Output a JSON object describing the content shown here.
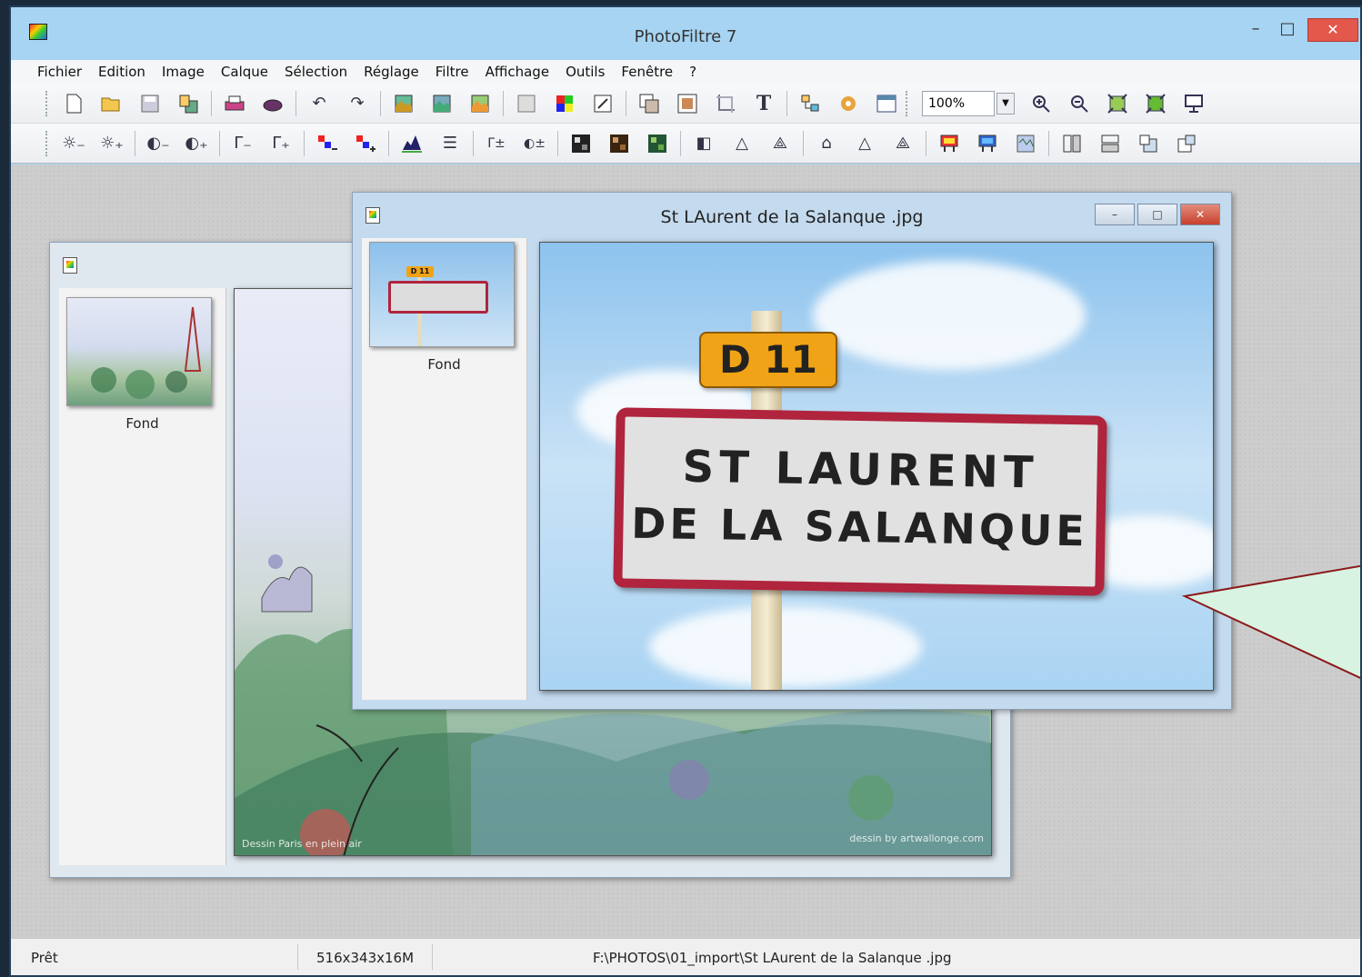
{
  "app": {
    "title": "PhotoFiltre 7"
  },
  "window_controls": {
    "minimize": "–",
    "maximize": "□",
    "close": "✕"
  },
  "menu": [
    "Fichier",
    "Edition",
    "Image",
    "Calque",
    "Sélection",
    "Réglage",
    "Filtre",
    "Affichage",
    "Outils",
    "Fenêtre",
    "?"
  ],
  "toolbar": {
    "zoom_value": "100%",
    "text_tool": "T"
  },
  "doc_back": {
    "title": "",
    "layer_name": "Fond"
  },
  "doc_front": {
    "title": "St LAurent de la Salanque .jpg",
    "layer_name": "Fond",
    "sign": {
      "route": "D 11",
      "line1": "ST LAURENT",
      "line2": "DE LA SALANQUE"
    }
  },
  "painting_text": {
    "left": "Dessin Paris en plein air",
    "right": "dessin by artwallonge.com"
  },
  "status": {
    "state": "Prêt",
    "image_info": "516x343x16M",
    "path": "F:\\PHOTOS\\01_import\\St LAurent de la Salanque .jpg"
  },
  "colors": {
    "titlebar": "#a7d4f2",
    "close": "#e4574b",
    "callout": "#d9f3e3",
    "callout_border": "#8b1a1a"
  }
}
